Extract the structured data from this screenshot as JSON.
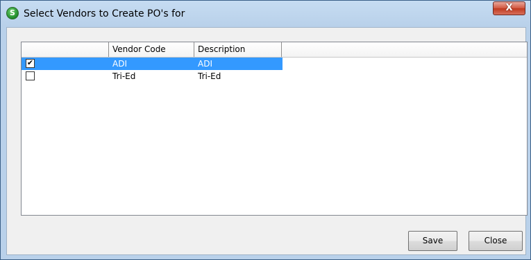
{
  "window": {
    "title": "Select Vendors to Create PO's for",
    "app_icon_letter": "S",
    "close_glyph": "X"
  },
  "grid": {
    "columns": [
      "",
      "Vendor Code",
      "Description"
    ],
    "rows": [
      {
        "checked": true,
        "vendor_code": "ADI",
        "description": "ADI",
        "selected": true
      },
      {
        "checked": false,
        "vendor_code": "Tri-Ed",
        "description": "Tri-Ed",
        "selected": false
      }
    ]
  },
  "buttons": {
    "save_label": "Save",
    "close_label": "Close"
  },
  "colors": {
    "selection": "#3399ff",
    "title_bar": "#b9d1ea",
    "close_button": "#c0391f"
  }
}
